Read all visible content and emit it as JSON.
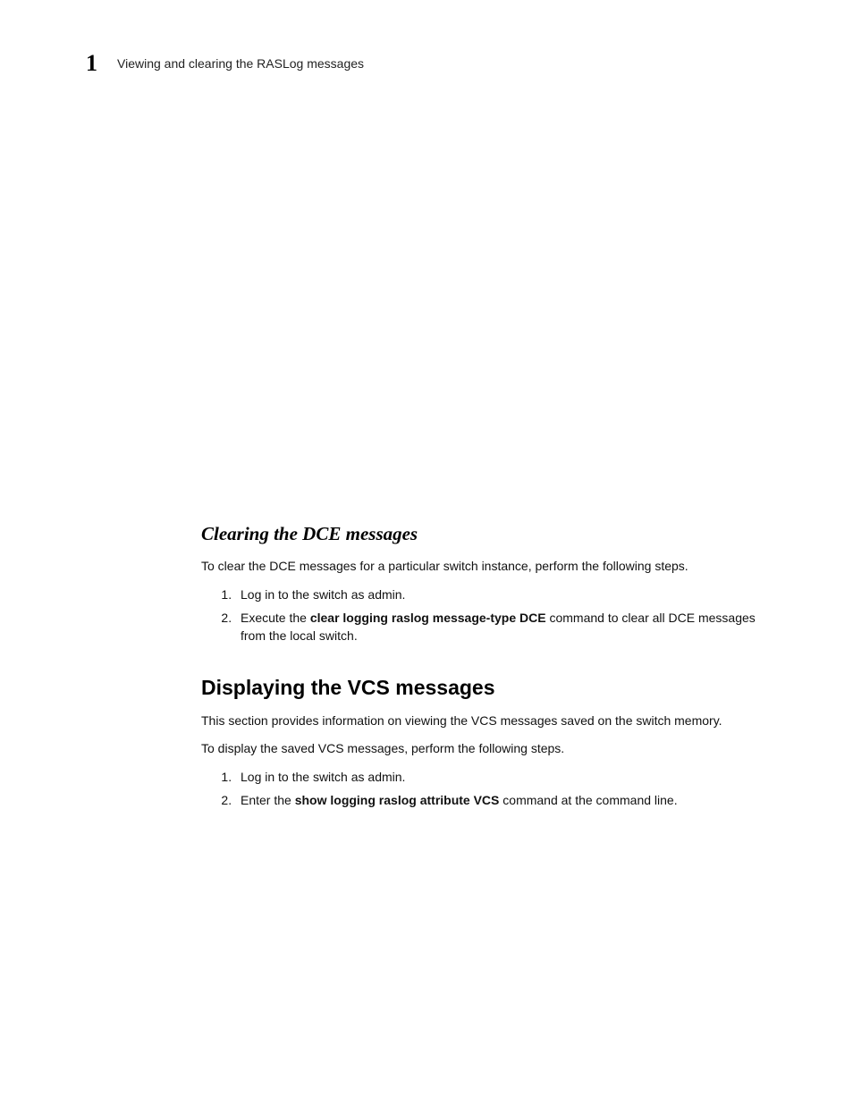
{
  "header": {
    "chapter_number": "1",
    "running_title": "Viewing and clearing the RASLog messages"
  },
  "section1": {
    "heading": "Clearing the DCE messages",
    "intro": "To clear the DCE messages for a particular switch instance, perform the following steps.",
    "step1": "Log in to the switch as admin.",
    "step2_pre": "Execute the ",
    "step2_cmd": "clear logging raslog message-type DCE",
    "step2_post": " command to clear all DCE messages from the local switch."
  },
  "section2": {
    "heading": "Displaying the VCS messages",
    "intro": "This section provides information on viewing the VCS messages saved on the switch memory.",
    "lead": "To display the saved VCS messages, perform the following steps.",
    "step1": "Log in to the switch as admin.",
    "step2_pre": "Enter the ",
    "step2_cmd": "show logging raslog attribute VCS",
    "step2_post": " command at the command line."
  }
}
